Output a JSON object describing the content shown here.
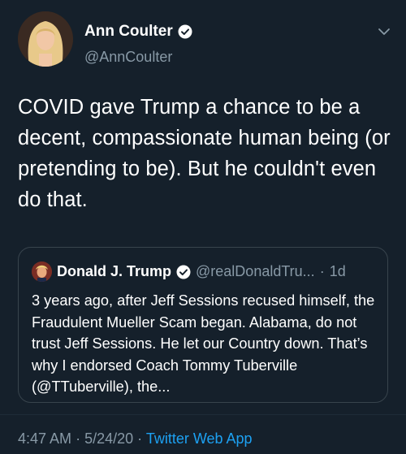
{
  "author": {
    "name": "Ann Coulter",
    "handle": "@AnnCoulter",
    "verified": true
  },
  "tweet": {
    "text": "COVID gave Trump a chance to be a decent, compassionate human being (or pretending to be). But he couldn't even do that."
  },
  "quoted_tweet": {
    "name": "Donald J. Trump",
    "handle": "@realDonaldTru...",
    "separator": "·",
    "time": "1d",
    "verified": true,
    "text": "3 years ago, after Jeff Sessions recused himself, the Fraudulent Mueller Scam began. Alabama, do not trust Jeff Sessions. He let our Country down. That’s why I endorsed Coach Tommy Tuberville (@TTuberville), the..."
  },
  "footer": {
    "time": "4:47 AM",
    "sep1": "·",
    "date": "5/24/20",
    "sep2": "·",
    "source": "Twitter Web App"
  },
  "colors": {
    "background": "#15202b",
    "secondary_text": "#8899a6",
    "link": "#1da1f2",
    "border": "#38444d"
  }
}
